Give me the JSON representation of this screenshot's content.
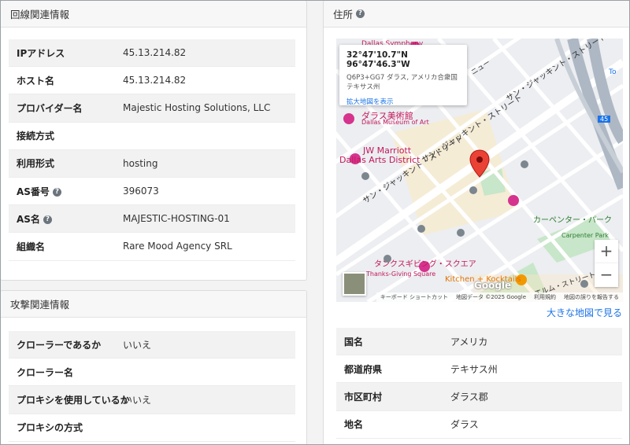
{
  "line_section": {
    "title": "回線関連情報",
    "rows": [
      {
        "label": "IPアドレス",
        "value": "45.13.214.82",
        "help": false
      },
      {
        "label": "ホスト名",
        "value": "45.13.214.82",
        "help": false
      },
      {
        "label": "プロバイダー名",
        "value": "Majestic Hosting Solutions, LLC",
        "help": false
      },
      {
        "label": "接続方式",
        "value": "",
        "help": false
      },
      {
        "label": "利用形式",
        "value": "hosting",
        "help": false
      },
      {
        "label": "AS番号",
        "value": "396073",
        "help": true
      },
      {
        "label": "AS名",
        "value": "MAJESTIC-HOSTING-01",
        "help": true
      },
      {
        "label": "組織名",
        "value": "Rare Mood Agency SRL",
        "help": false
      }
    ]
  },
  "attack_section": {
    "title": "攻撃関連情報",
    "rows": [
      {
        "label": "クローラーであるか",
        "value": "いいえ"
      },
      {
        "label": "クローラー名",
        "value": ""
      },
      {
        "label": "プロキシを使用しているか",
        "value": "いいえ"
      },
      {
        "label": "プロキシの方式",
        "value": ""
      }
    ]
  },
  "address_section": {
    "title": "住所",
    "help_glyph": "?",
    "map": {
      "popup_coords": "32°47'10.7\"N 96°47'46.3\"W",
      "popup_address": "Q6P3+GG7 ダラス, アメリカ合衆国 テキサス州",
      "popup_link": "拡大地図を表示",
      "labels": {
        "dallas_symphony": "Dallas Symphony",
        "museum_ja": "ダラス美術館",
        "museum_en": "Dallas Museum of Art",
        "jw_marriott": "JW Marriott",
        "jw_marriott2": "Dallas Arts District",
        "street_1": "サン・ジャッキント・ストリート",
        "street_2": "サン・ジャッキント・ストリート",
        "street_3": "サン・ジャッキント・ストリート",
        "street_top": "ニュー",
        "carpenter_ja": "カーペンター・パーク",
        "carpenter_en": "Carpenter Park",
        "thanks_ja": "タンクスギビング・スクエア",
        "thanks_en": "Thanks-Giving Square",
        "kitchen": "Kitchen + Kocktails",
        "elm_street": "エルム・ストリート",
        "highway": "45",
        "corner_label": "To"
      },
      "zoom_in": "+",
      "zoom_out": "−",
      "google": "Google",
      "footer": {
        "shortcuts": "キーボード ショートカット",
        "data": "地図データ ©2025 Google",
        "terms": "利用規約",
        "report": "地図の誤りを報告する"
      }
    },
    "large_map_link": "大きな地図で見る",
    "rows": [
      {
        "label": "国名",
        "value": "アメリカ"
      },
      {
        "label": "都道府県",
        "value": "テキサス州"
      },
      {
        "label": "市区町村",
        "value": "ダラス郡"
      },
      {
        "label": "地名",
        "value": "ダラス"
      }
    ]
  },
  "colors": {
    "marker": "#ea4335",
    "link": "#1a73e8",
    "poi_pink": "#d6338e",
    "poi_orange": "#f29900",
    "park": "#c8e6c9",
    "highway": "#aeb8c4"
  }
}
